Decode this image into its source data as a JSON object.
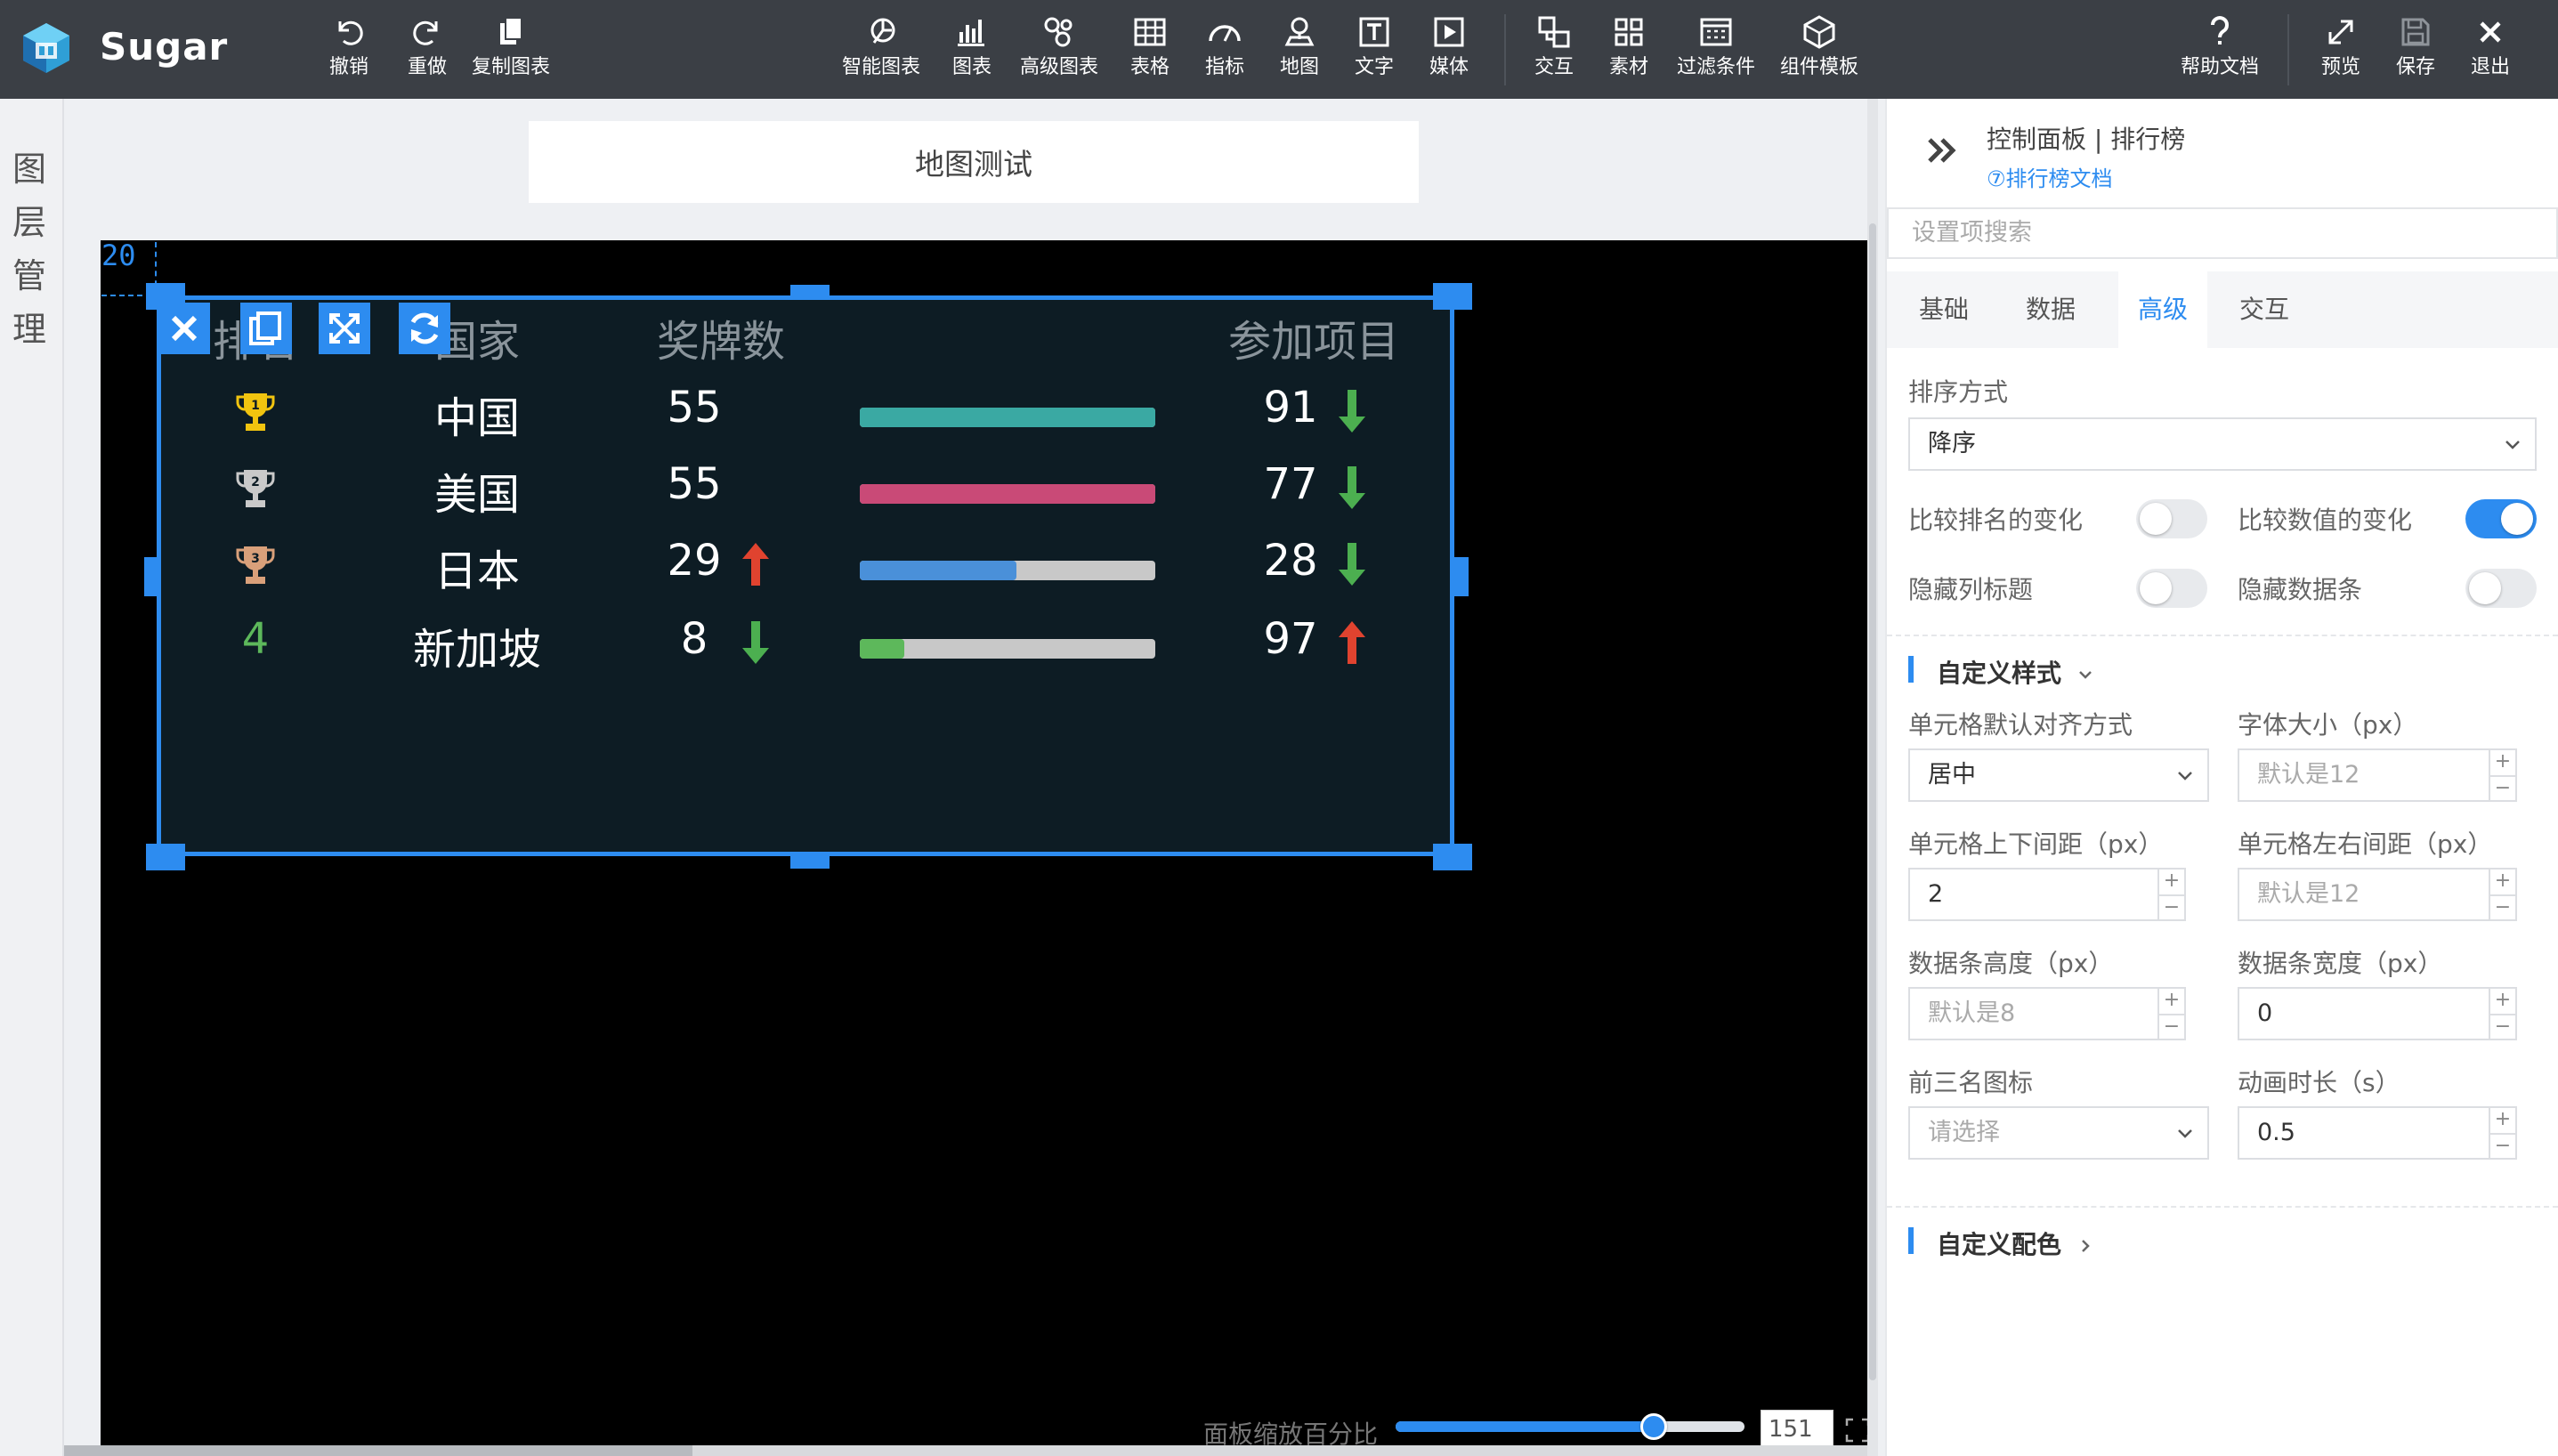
{
  "app": {
    "brand": "Sugar"
  },
  "toolbar": {
    "undo": "撤销",
    "redo": "重做",
    "copy_chart": "复制图表",
    "smart_chart": "智能图表",
    "chart": "图表",
    "advanced_chart": "高级图表",
    "table": "表格",
    "indicator": "指标",
    "map": "地图",
    "text": "文字",
    "media": "媒体",
    "interaction": "交互",
    "assets": "素材",
    "filter": "过滤条件",
    "template": "组件模板",
    "help": "帮助文档",
    "preview": "预览",
    "save": "保存",
    "exit": "退出"
  },
  "left_strip": {
    "chars": [
      "图",
      "层",
      "管",
      "理"
    ]
  },
  "canvas": {
    "page_title": "地图测试",
    "grid_label": "20",
    "zoom_label": "面板缩放百分比",
    "zoom_value": "151",
    "zoom_percent": 0.74
  },
  "ranking": {
    "headers": {
      "rank": "排名",
      "country": "国家",
      "medals": "奖牌数",
      "events": "参加项目"
    },
    "rows": [
      {
        "rank": "1",
        "rank_icon": "gold-trophy-icon",
        "country": "中国",
        "medals": "55",
        "medal_trend": "",
        "bar_ratio": 1.0,
        "bar_color": "#3aa9a3",
        "events": "91",
        "event_trend": "down"
      },
      {
        "rank": "2",
        "rank_icon": "silver-trophy-icon",
        "country": "美国",
        "medals": "55",
        "medal_trend": "",
        "bar_ratio": 1.0,
        "bar_color": "#c94a77",
        "events": "77",
        "event_trend": "down"
      },
      {
        "rank": "3",
        "rank_icon": "bronze-trophy-icon",
        "country": "日本",
        "medals": "29",
        "medal_trend": "up",
        "bar_ratio": 0.53,
        "bar_color": "#4a90d9",
        "events": "28",
        "event_trend": "down"
      },
      {
        "rank": "4",
        "rank_icon": "",
        "country": "新加坡",
        "medals": "8",
        "medal_trend": "down",
        "bar_ratio": 0.15,
        "bar_color": "#5db85b",
        "events": "97",
        "event_trend": "up"
      }
    ],
    "colors": {
      "up": "#e0432f",
      "down": "#4caf50",
      "rank4": "#5db85b"
    }
  },
  "panel": {
    "title": "控制面板 | 排行榜",
    "doc_link": "⑦排行榜文档",
    "search_placeholder": "设置项搜索",
    "tabs": [
      "基础",
      "数据",
      "高级",
      "交互"
    ],
    "active_tab": "高级",
    "sort_label": "排序方式",
    "sort_value": "降序",
    "compare_rank_label": "比较排名的变化",
    "compare_rank_on": false,
    "compare_value_label": "比较数值的变化",
    "compare_value_on": true,
    "hide_header_label": "隐藏列标题",
    "hide_header_on": false,
    "hide_bar_label": "隐藏数据条",
    "hide_bar_on": false,
    "custom_style_title": "自定义样式",
    "align_label": "单元格默认对齐方式",
    "align_value": "居中",
    "font_size_label": "字体大小（px）",
    "font_size_placeholder": "默认是12",
    "cell_v_padding_label": "单元格上下间距（px）",
    "cell_v_padding_value": "2",
    "cell_h_padding_label": "单元格左右间距（px）",
    "cell_h_padding_placeholder": "默认是12",
    "bar_height_label": "数据条高度（px）",
    "bar_height_placeholder": "默认是8",
    "bar_width_label": "数据条宽度（px）",
    "bar_width_value": "0",
    "top3_icon_label": "前三名图标",
    "top3_icon_placeholder": "请选择",
    "anim_label": "动画时长（s）",
    "anim_value": "0.5",
    "custom_color_title": "自定义配色",
    "accent": "#2d8cf0"
  }
}
